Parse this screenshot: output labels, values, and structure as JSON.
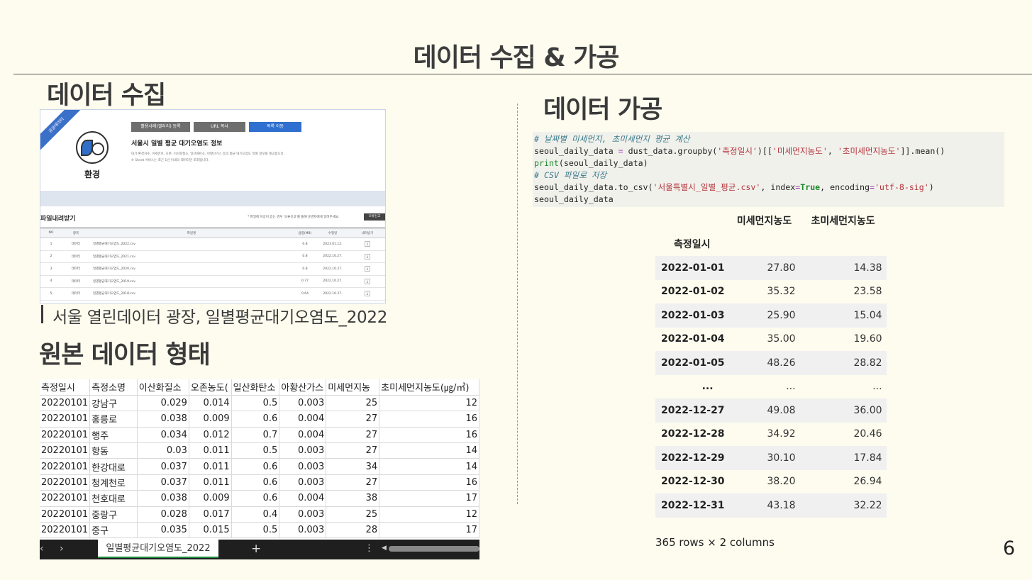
{
  "slide": {
    "title": "데이터 수집 & 가공",
    "page_number": "6"
  },
  "collect": {
    "heading": "데이터 수집",
    "portal": {
      "ribbon": "공공데이터",
      "category": "환경",
      "buttons": [
        "활용사례(갤러리) 등록",
        "URL 복사",
        "목록 이동"
      ],
      "dataset_title": "서울시 일별 평균 대기오염도 정보",
      "description_1": "대기 환경지수, 미세먼지, 오존, 이산화질소, 일산화탄소, 아황산가스 등의 평균 대기오염도 일별 정보를 제공합니다.",
      "description_2": "※ Sheet 서비스는 최근 1년 이내의 데이터만 조회됩니다.",
      "download_title": "파일내려받기",
      "download_note": "* 파일에 이상이 있는 경우 '오류신고'를 통해 운영자에게 알려주세요.",
      "report_button": "오류신고",
      "columns": [
        "NO",
        "항목",
        "파일명",
        "용량(MB)",
        "수정일",
        "내려받기"
      ],
      "rows": [
        {
          "no": "1",
          "item": "데이터",
          "file": "일별평균대기오염도_2022.csv",
          "size": "0.8",
          "date": "2023.01.12."
        },
        {
          "no": "2",
          "item": "데이터",
          "file": "일별평균대기오염도_2021.csv",
          "size": "0.8",
          "date": "2022.10.27."
        },
        {
          "no": "3",
          "item": "데이터",
          "file": "일별평균대기오염도_2020.csv",
          "size": "0.8",
          "date": "2022.10.27."
        },
        {
          "no": "4",
          "item": "데이터",
          "file": "일별평균대기오염도_2019.csv",
          "size": "0.77",
          "date": "2022.10.27."
        },
        {
          "no": "5",
          "item": "데이터",
          "file": "일별평균대기오염도_2018.csv",
          "size": "0.64",
          "date": "2022.10.27."
        }
      ]
    },
    "caption": "서울 열린데이터 광장, 일별평균대기오염도_2022"
  },
  "raw": {
    "heading": "원본 데이터 형태",
    "columns": [
      "측정일시",
      "측정소명",
      "이산화질소",
      "오존농도(",
      "일산화탄소",
      "아황산가스",
      "미세먼지농",
      "초미세먼지농도(㎍/㎥)"
    ],
    "rows": [
      [
        "20220101",
        "강남구",
        "0.029",
        "0.014",
        "0.5",
        "0.003",
        "25",
        "12"
      ],
      [
        "20220101",
        "홍릉로",
        "0.038",
        "0.009",
        "0.6",
        "0.004",
        "27",
        "16"
      ],
      [
        "20220101",
        "행주",
        "0.034",
        "0.012",
        "0.7",
        "0.004",
        "27",
        "16"
      ],
      [
        "20220101",
        "항동",
        "0.03",
        "0.011",
        "0.5",
        "0.003",
        "27",
        "14"
      ],
      [
        "20220101",
        "한강대로",
        "0.037",
        "0.011",
        "0.6",
        "0.003",
        "34",
        "14"
      ],
      [
        "20220101",
        "청계천로",
        "0.037",
        "0.011",
        "0.6",
        "0.003",
        "27",
        "16"
      ],
      [
        "20220101",
        "천호대로",
        "0.038",
        "0.009",
        "0.6",
        "0.004",
        "38",
        "17"
      ],
      [
        "20220101",
        "중랑구",
        "0.028",
        "0.017",
        "0.4",
        "0.003",
        "25",
        "12"
      ],
      [
        "20220101",
        "중구",
        "0.035",
        "0.015",
        "0.5",
        "0.003",
        "28",
        "17"
      ]
    ],
    "sheet_tab": "일별평균대기오염도_2022",
    "tab_add": "+",
    "tab_prev": "‹",
    "tab_next": "›",
    "tab_more": "⋮"
  },
  "process": {
    "heading": "데이터 가공",
    "code": {
      "comment_1": "# 날짜별 미세먼지, 초미세먼지 평균 계산",
      "line_1_a": "seoul_daily_data ",
      "line_1_op": "=",
      "line_1_b": " dust_data.groupby(",
      "line_1_s1": "'측정일시'",
      "line_1_c": ")[[",
      "line_1_s2": "'미세먼지농도'",
      "line_1_d": ", ",
      "line_1_s3": "'초미세먼지농도'",
      "line_1_e": "]].mean()",
      "line_2_fn": "print",
      "line_2_rest": "(seoul_daily_data)",
      "comment_2": "# CSV 파일로 저장",
      "line_3_a": "seoul_daily_data.to_csv(",
      "line_3_s1": "'서울특별시_일별_평균.csv'",
      "line_3_b": ", index",
      "line_3_op1": "=",
      "line_3_kw": "True",
      "line_3_c": ", encoding",
      "line_3_op2": "=",
      "line_3_s2": "'utf-8-sig'",
      "line_3_d": ")",
      "line_4": "seoul_daily_data"
    },
    "dataframe": {
      "columns": [
        "미세먼지농도",
        "초미세먼지농도"
      ],
      "index_name": "측정일시",
      "rows": [
        {
          "date": "2022-01-01",
          "pm10": "27.80",
          "pm25": "14.38"
        },
        {
          "date": "2022-01-02",
          "pm10": "35.32",
          "pm25": "23.58"
        },
        {
          "date": "2022-01-03",
          "pm10": "25.90",
          "pm25": "15.04"
        },
        {
          "date": "2022-01-04",
          "pm10": "35.00",
          "pm25": "19.60"
        },
        {
          "date": "2022-01-05",
          "pm10": "48.26",
          "pm25": "28.82"
        },
        {
          "date": "...",
          "pm10": "...",
          "pm25": "..."
        },
        {
          "date": "2022-12-27",
          "pm10": "49.08",
          "pm25": "36.00"
        },
        {
          "date": "2022-12-28",
          "pm10": "34.92",
          "pm25": "20.46"
        },
        {
          "date": "2022-12-29",
          "pm10": "30.10",
          "pm25": "17.84"
        },
        {
          "date": "2022-12-30",
          "pm10": "38.20",
          "pm25": "26.94"
        },
        {
          "date": "2022-12-31",
          "pm10": "43.18",
          "pm25": "32.22"
        }
      ],
      "footer": "365 rows × 2 columns"
    }
  },
  "colors": {
    "background": "#fdfcef",
    "portal_accent": "#2f6fd0",
    "sheet_tab_underline": "#1f8b3e"
  }
}
